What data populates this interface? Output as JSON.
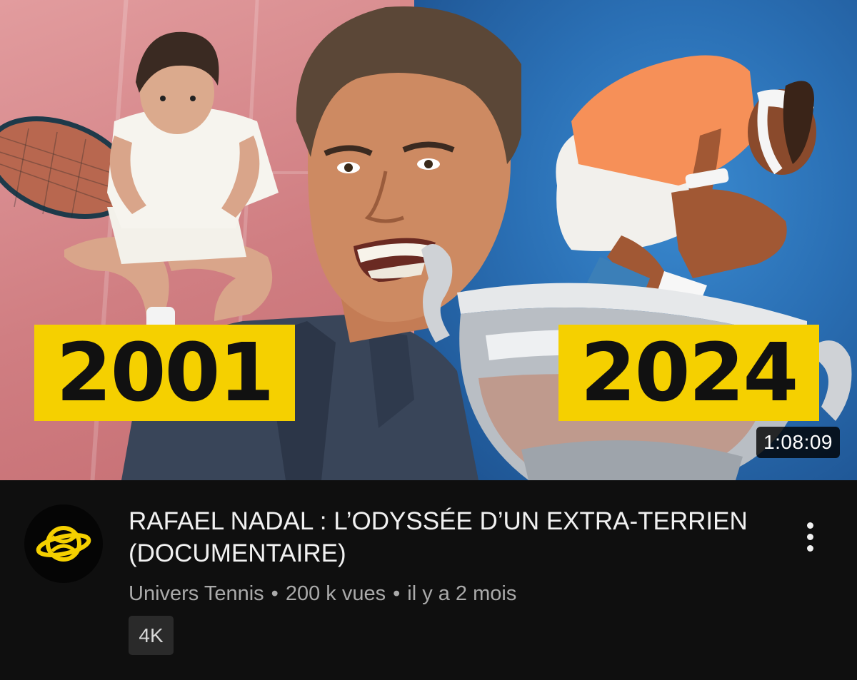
{
  "video": {
    "duration": "1:08:09",
    "thumbnail": {
      "year_left": "2001",
      "year_right": "2024",
      "colors": {
        "clay": "#d98a8a",
        "hard_court": "#2a6fb4",
        "label_yellow": "#f5d000"
      }
    },
    "title": "RAFAEL NADAL : L’ODYSSÉE D’UN EXTRA-TERRIEN\n(DOCUMENTAIRE)",
    "channel": "Univers Tennis",
    "views": "200 k vues",
    "age": "il y a 2 mois",
    "separator": "•",
    "badge": "4K",
    "channel_avatar": {
      "icon": "planet-tennis-ball-icon",
      "color": "#f5d000"
    },
    "menu_icon": "more-vertical-icon"
  }
}
